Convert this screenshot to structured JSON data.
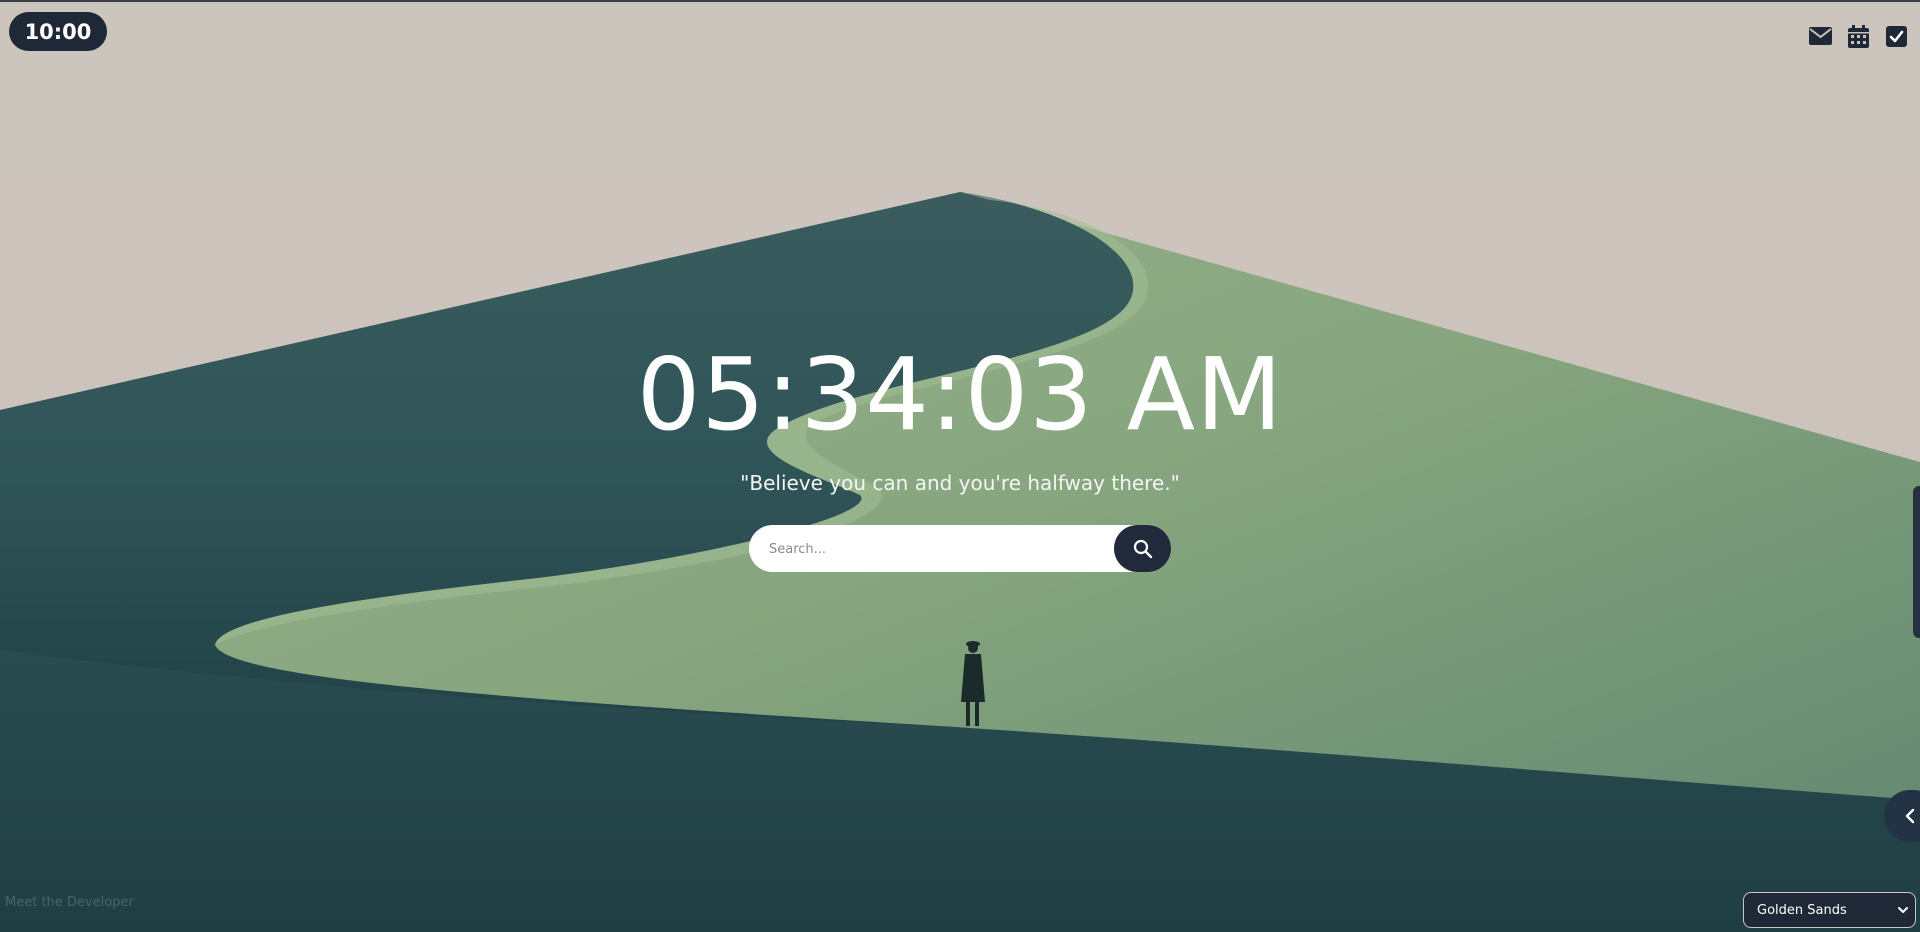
{
  "timer": {
    "value": "10:00"
  },
  "top_icons": [
    {
      "name": "mail-icon",
      "label": "mail"
    },
    {
      "name": "calendar-icon",
      "label": "calendar"
    },
    {
      "name": "checkbox-icon",
      "label": "tasks"
    }
  ],
  "clock": {
    "time": "05:34:03 AM"
  },
  "quote": {
    "text": "\"Believe you can and you're halfway there.\""
  },
  "search": {
    "placeholder": "Search..."
  },
  "footer": {
    "developer_link": "Meet the Developer"
  },
  "theme_select": {
    "selected": "Golden Sands"
  },
  "colors": {
    "accent_dark": "#1f2837",
    "sky": "#cbc3bc",
    "dune_dark": "#2f5558",
    "dune_light": "#8fac84"
  }
}
